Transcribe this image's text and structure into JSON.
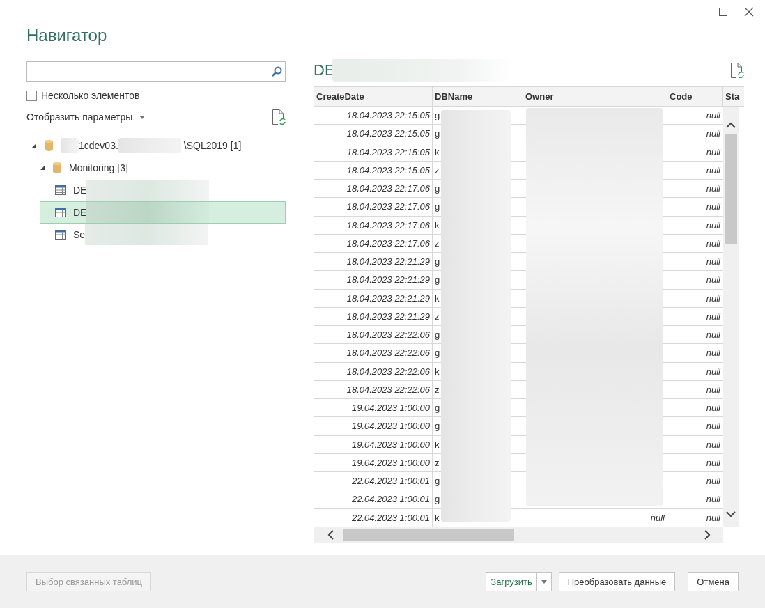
{
  "window": {
    "title": "Навигатор"
  },
  "multi_select": {
    "label": "Несколько элементов",
    "checked": false
  },
  "display_options": {
    "label": "Отобразить параметры"
  },
  "tree": [
    {
      "kind": "server",
      "parts": [
        "1cdev03.",
        "\\SQL2019 [1]"
      ],
      "expanded": true,
      "children": [
        {
          "kind": "database",
          "parts": [
            "Monitoring [3]"
          ],
          "expanded": true,
          "children": [
            {
              "kind": "table",
              "parts": [
                "DE"
              ],
              "selected": false
            },
            {
              "kind": "table",
              "parts": [
                "DE"
              ],
              "selected": true
            },
            {
              "kind": "table",
              "parts": [
                "Se"
              ],
              "selected": false
            }
          ]
        }
      ]
    }
  ],
  "preview": {
    "title": "DE",
    "columns": [
      "CreateDate",
      "DBName",
      "Owner",
      "Code",
      "Sta"
    ],
    "rows": [
      {
        "create_date": "18.04.2023 22:15:05",
        "db_name": "g",
        "code": "null"
      },
      {
        "create_date": "18.04.2023 22:15:05",
        "db_name": "g",
        "code": "null"
      },
      {
        "create_date": "18.04.2023 22:15:05",
        "db_name": "k",
        "code": "null"
      },
      {
        "create_date": "18.04.2023 22:15:05",
        "db_name": "z",
        "code": "null"
      },
      {
        "create_date": "18.04.2023 22:17:06",
        "db_name": "g",
        "code": "null"
      },
      {
        "create_date": "18.04.2023 22:17:06",
        "db_name": "g",
        "code": "null"
      },
      {
        "create_date": "18.04.2023 22:17:06",
        "db_name": "k",
        "code": "null"
      },
      {
        "create_date": "18.04.2023 22:17:06",
        "db_name": "z",
        "code": "null"
      },
      {
        "create_date": "18.04.2023 22:21:29",
        "db_name": "g",
        "code": "null"
      },
      {
        "create_date": "18.04.2023 22:21:29",
        "db_name": "g",
        "code": "null"
      },
      {
        "create_date": "18.04.2023 22:21:29",
        "db_name": "k",
        "code": "null"
      },
      {
        "create_date": "18.04.2023 22:21:29",
        "db_name": "z",
        "code": "null"
      },
      {
        "create_date": "18.04.2023 22:22:06",
        "db_name": "g",
        "code": "null"
      },
      {
        "create_date": "18.04.2023 22:22:06",
        "db_name": "g",
        "code": "null"
      },
      {
        "create_date": "18.04.2023 22:22:06",
        "db_name": "k",
        "code": "null"
      },
      {
        "create_date": "18.04.2023 22:22:06",
        "db_name": "z",
        "code": "null"
      },
      {
        "create_date": "19.04.2023 1:00:00",
        "db_name": "g",
        "code": "null"
      },
      {
        "create_date": "19.04.2023 1:00:00",
        "db_name": "g",
        "code": "null"
      },
      {
        "create_date": "19.04.2023 1:00:00",
        "db_name": "k",
        "code": "null"
      },
      {
        "create_date": "19.04.2023 1:00:00",
        "db_name": "z",
        "code": "null"
      },
      {
        "create_date": "22.04.2023 1:00:01",
        "db_name": "g",
        "code": "null"
      },
      {
        "create_date": "22.04.2023 1:00:01",
        "db_name": "g",
        "code": "null"
      },
      {
        "create_date": "22.04.2023 1:00:01",
        "db_name": "k",
        "owner": "null",
        "code": "null"
      }
    ]
  },
  "buttons": [
    {
      "kind": "plain",
      "label": "Выбор связанных таблиц",
      "disabled": true
    },
    {
      "kind": "split",
      "label": "Загрузить",
      "disabled": false
    },
    {
      "kind": "plain",
      "label": "Преобразовать данные",
      "disabled": false
    },
    {
      "kind": "plain",
      "label": "Отмена",
      "disabled": false
    }
  ]
}
